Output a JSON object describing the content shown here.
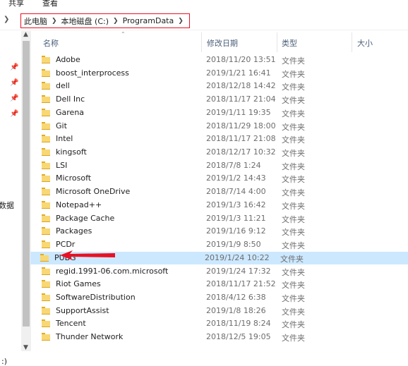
{
  "ribbon": {
    "tab_share": "共享",
    "tab_view": "查看"
  },
  "breadcrumb": [
    "此电脑",
    "本地磁盘 (C:)",
    "ProgramData"
  ],
  "columns": {
    "name": "名称",
    "date": "修改日期",
    "type": "类型",
    "size": "大小"
  },
  "nav": {
    "label": "数据",
    "label2": ":)"
  },
  "files": [
    {
      "name": "Adobe",
      "date": "2018/11/20 13:51",
      "type": "文件夹"
    },
    {
      "name": "boost_interprocess",
      "date": "2019/1/21 16:41",
      "type": "文件夹"
    },
    {
      "name": "dell",
      "date": "2018/12/18 14:42",
      "type": "文件夹"
    },
    {
      "name": "Dell Inc",
      "date": "2018/11/17 21:04",
      "type": "文件夹"
    },
    {
      "name": "Garena",
      "date": "2019/1/11 19:35",
      "type": "文件夹"
    },
    {
      "name": "Git",
      "date": "2018/11/29 18:00",
      "type": "文件夹"
    },
    {
      "name": "Intel",
      "date": "2018/11/17 21:08",
      "type": "文件夹"
    },
    {
      "name": "kingsoft",
      "date": "2018/12/17 10:32",
      "type": "文件夹"
    },
    {
      "name": "LSI",
      "date": "2018/7/8 1:24",
      "type": "文件夹"
    },
    {
      "name": "Microsoft",
      "date": "2019/1/2 14:43",
      "type": "文件夹"
    },
    {
      "name": "Microsoft OneDrive",
      "date": "2018/7/14 4:00",
      "type": "文件夹"
    },
    {
      "name": "Notepad++",
      "date": "2019/1/3 16:42",
      "type": "文件夹"
    },
    {
      "name": "Package Cache",
      "date": "2019/1/3 11:21",
      "type": "文件夹"
    },
    {
      "name": "Packages",
      "date": "2019/1/16 9:12",
      "type": "文件夹"
    },
    {
      "name": "PCDr",
      "date": "2019/1/9 8:50",
      "type": "文件夹"
    },
    {
      "name": "PUBG",
      "date": "2019/1/24 10:22",
      "type": "文件夹",
      "selected": true
    },
    {
      "name": "regid.1991-06.com.microsoft",
      "date": "2019/1/24 17:32",
      "type": "文件夹"
    },
    {
      "name": "Riot Games",
      "date": "2018/11/17 21:52",
      "type": "文件夹"
    },
    {
      "name": "SoftwareDistribution",
      "date": "2018/4/12 6:38",
      "type": "文件夹"
    },
    {
      "name": "SupportAssist",
      "date": "2019/1/8 18:26",
      "type": "文件夹"
    },
    {
      "name": "Tencent",
      "date": "2018/11/19 8:24",
      "type": "文件夹"
    },
    {
      "name": "Thunder Network",
      "date": "2018/12/5 19:05",
      "type": "文件夹"
    }
  ],
  "colors": {
    "selection": "#cce8ff",
    "accent": "#e81123",
    "folder": "#f8d775"
  }
}
